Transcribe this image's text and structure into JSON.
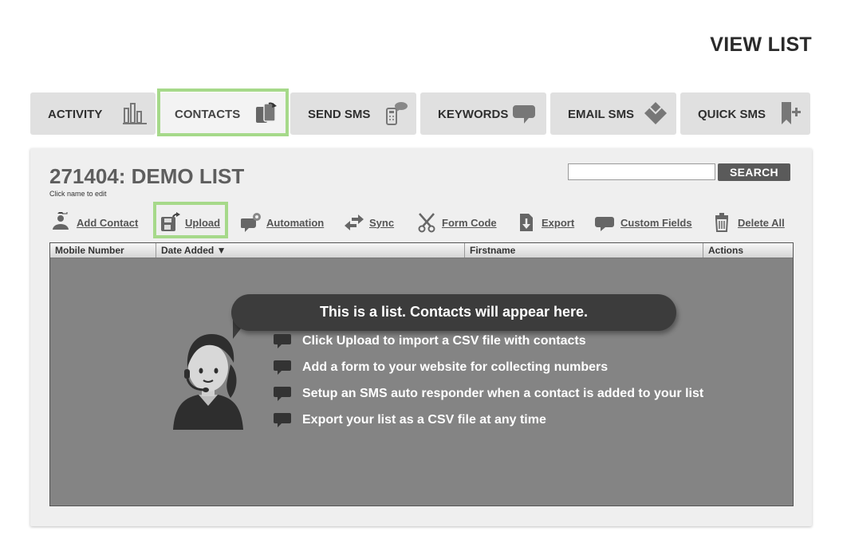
{
  "header": {
    "title": "VIEW LIST"
  },
  "tabs": [
    {
      "label": "ACTIVITY",
      "icon": "bar-chart-icon"
    },
    {
      "label": "CONTACTS",
      "icon": "contacts-card-icon",
      "active": true
    },
    {
      "label": "SEND SMS",
      "icon": "phone-message-icon"
    },
    {
      "label": "KEYWORDS",
      "icon": "speech-bubble-icon"
    },
    {
      "label": "EMAIL SMS",
      "icon": "envelope-icon"
    },
    {
      "label": "QUICK SMS",
      "icon": "bookmark-plus-icon"
    }
  ],
  "list": {
    "title": "271404: DEMO LIST",
    "hint": "Click name to edit"
  },
  "search": {
    "placeholder": "",
    "button_label": "SEARCH"
  },
  "actions": [
    {
      "label": "Add Contact",
      "icon": "add-contact-icon"
    },
    {
      "label": "Upload",
      "icon": "upload-icon"
    },
    {
      "label": "Automation",
      "icon": "automation-icon"
    },
    {
      "label": "Sync",
      "icon": "sync-icon"
    },
    {
      "label": "Form Code",
      "icon": "scissors-icon"
    },
    {
      "label": "Export",
      "icon": "export-icon"
    },
    {
      "label": "Custom Fields",
      "icon": "custom-fields-icon"
    },
    {
      "label": "Delete All",
      "icon": "trash-icon"
    }
  ],
  "table": {
    "columns": [
      "Mobile Number",
      "Date Added ▼",
      "Firstname",
      "Actions"
    ]
  },
  "empty_state": {
    "headline": "This is a list. Contacts will appear here.",
    "tips": [
      "Click Upload to import a CSV file with contacts",
      "Add a form to your website for collecting numbers",
      "Setup an SMS auto responder when a contact is added to your list",
      "Export your list as a CSV file at any time"
    ]
  },
  "colors": {
    "highlight": "#a6d98a",
    "table_body": "#848484",
    "bubble": "#3c3c3c"
  }
}
